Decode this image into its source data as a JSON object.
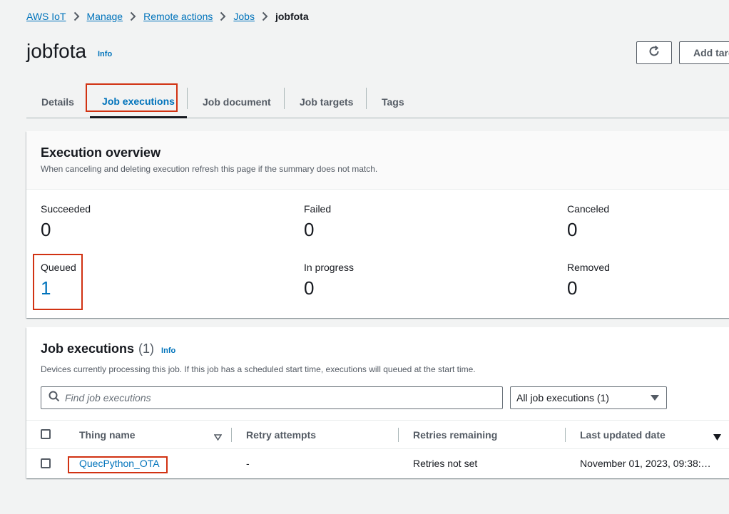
{
  "breadcrumb": [
    "AWS IoT",
    "Manage",
    "Remote actions",
    "Jobs"
  ],
  "breadcrumb_current": "jobfota",
  "page": {
    "title": "jobfota",
    "info": "Info"
  },
  "actions": {
    "add_label": "Add target"
  },
  "tabs": [
    "Details",
    "Job executions",
    "Job document",
    "Job targets",
    "Tags"
  ],
  "active_tab": "Job executions",
  "overview": {
    "title": "Execution overview",
    "description": "When canceling and deleting execution refresh this page if the summary does not match.",
    "stats": {
      "succeeded": {
        "label": "Succeeded",
        "value": "0"
      },
      "failed": {
        "label": "Failed",
        "value": "0"
      },
      "canceled": {
        "label": "Canceled",
        "value": "0"
      },
      "queued": {
        "label": "Queued",
        "value": "1"
      },
      "in_progress": {
        "label": "In progress",
        "value": "0"
      },
      "removed": {
        "label": "Removed",
        "value": "0"
      }
    }
  },
  "executions": {
    "title": "Job executions",
    "count": "(1)",
    "info": "Info",
    "description": "Devices currently processing this job. If this job has a scheduled start time, executions will queued at the start time.",
    "search_placeholder": "Find job executions",
    "filter_value": "All job executions (1)",
    "columns": [
      "Thing name",
      "Retry attempts",
      "Retries remaining",
      "Last updated date"
    ],
    "rows": [
      {
        "thing_name": "QuecPython_OTA",
        "retry_attempts": "-",
        "retries_remaining": "Retries not set",
        "last_updated": "November 01, 2023, 09:38:…"
      }
    ]
  },
  "colors": {
    "link": "#0073bb",
    "highlight": "#d13212",
    "text": "#16191f",
    "muted": "#545b64"
  },
  "icons": [
    "chevron-right-icon",
    "refresh-icon",
    "search-icon",
    "sort-icon",
    "sort-desc-icon",
    "caret-down-icon"
  ]
}
